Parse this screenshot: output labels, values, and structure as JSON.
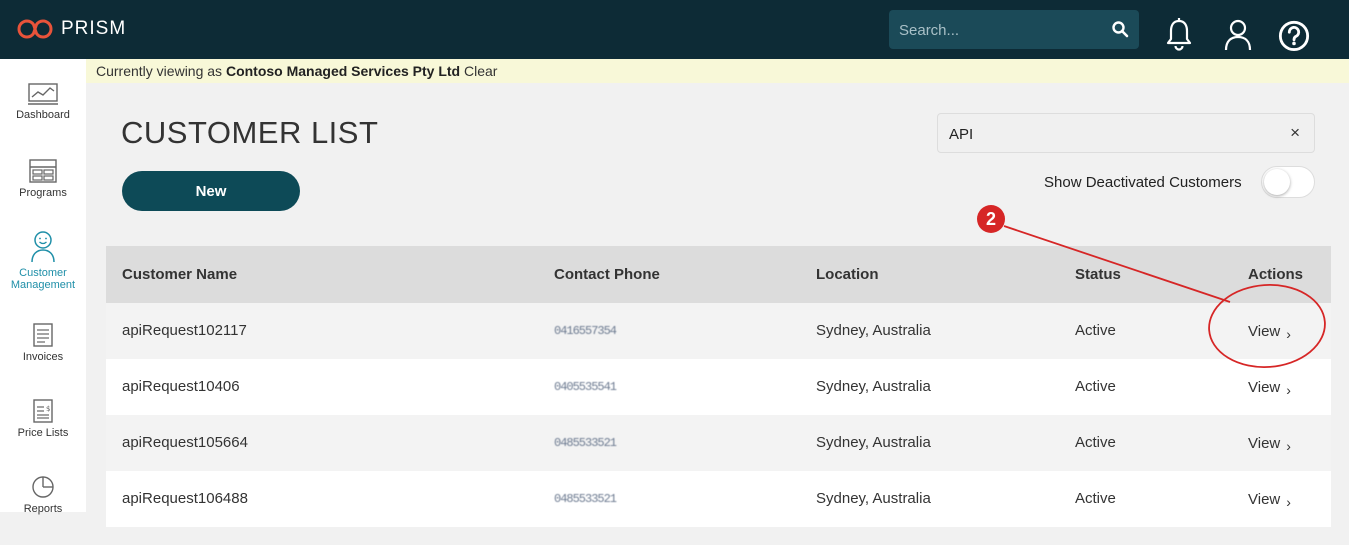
{
  "app": {
    "name": "PRISM"
  },
  "header": {
    "search_placeholder": "Search...",
    "icons": [
      "bell-icon",
      "user-icon",
      "help-icon"
    ]
  },
  "sidebar": {
    "items": [
      {
        "label": "Dashboard",
        "icon": "chart-icon",
        "active": false
      },
      {
        "label": "Programs",
        "icon": "grid-icon",
        "active": false
      },
      {
        "label": "Customer\nManagement",
        "label_line1": "Customer",
        "label_line2": "Management",
        "icon": "smiley-user-icon",
        "active": true
      },
      {
        "label": "Invoices",
        "icon": "document-icon",
        "active": false
      },
      {
        "label": "Price Lists",
        "icon": "price-list-icon",
        "active": false
      },
      {
        "label": "Reports",
        "icon": "pie-chart-icon",
        "active": false
      }
    ]
  },
  "banner": {
    "prefix": "Currently viewing as",
    "org": "Contoso Managed Services Pty Ltd",
    "clear": "Clear"
  },
  "main": {
    "title": "CUSTOMER LIST",
    "new_button": "New",
    "filter_value": "API",
    "filter_clear": "×",
    "toggle_label": "Show Deactivated Customers",
    "toggle_on": false
  },
  "table": {
    "headers": {
      "name": "Customer Name",
      "phone": "Contact Phone",
      "location": "Location",
      "status": "Status",
      "actions": "Actions"
    },
    "rows": [
      {
        "name": "apiRequest102117",
        "phone": "0416557354",
        "location": "Sydney, Australia",
        "status": "Active",
        "action": "View"
      },
      {
        "name": "apiRequest10406",
        "phone": "0405535541",
        "location": "Sydney, Australia",
        "status": "Active",
        "action": "View"
      },
      {
        "name": "apiRequest105664",
        "phone": "0485533521",
        "location": "Sydney, Australia",
        "status": "Active",
        "action": "View"
      },
      {
        "name": "apiRequest106488",
        "phone": "0485533521",
        "location": "Sydney, Australia",
        "status": "Active",
        "action": "View"
      }
    ]
  },
  "annotation": {
    "number": "2",
    "color": "#d62626"
  },
  "colors": {
    "topbar": "#0d2b36",
    "accent": "#0d4a57",
    "active_nav": "#1f8fa8",
    "banner": "#f8f8d8"
  }
}
